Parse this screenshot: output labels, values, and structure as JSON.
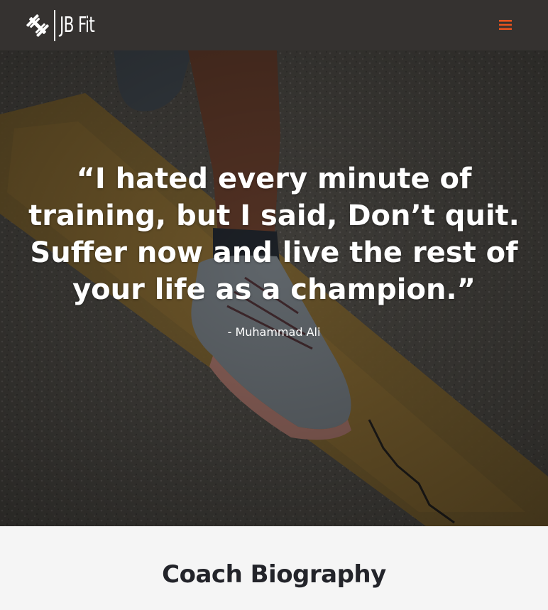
{
  "header": {
    "logo_text": "JB Fit",
    "menu_icon": "hamburger-icon",
    "accent_color": "#e8531e",
    "background_color": "#353230"
  },
  "hero": {
    "quote": "“I hated every minute of training, but I said, Don’t quit. Suffer now and live the rest of your life as a champion.”",
    "author": "- Muhammad Ali",
    "image_subject": "runner-shoe-on-road"
  },
  "bio": {
    "title": "Coach Biography"
  }
}
